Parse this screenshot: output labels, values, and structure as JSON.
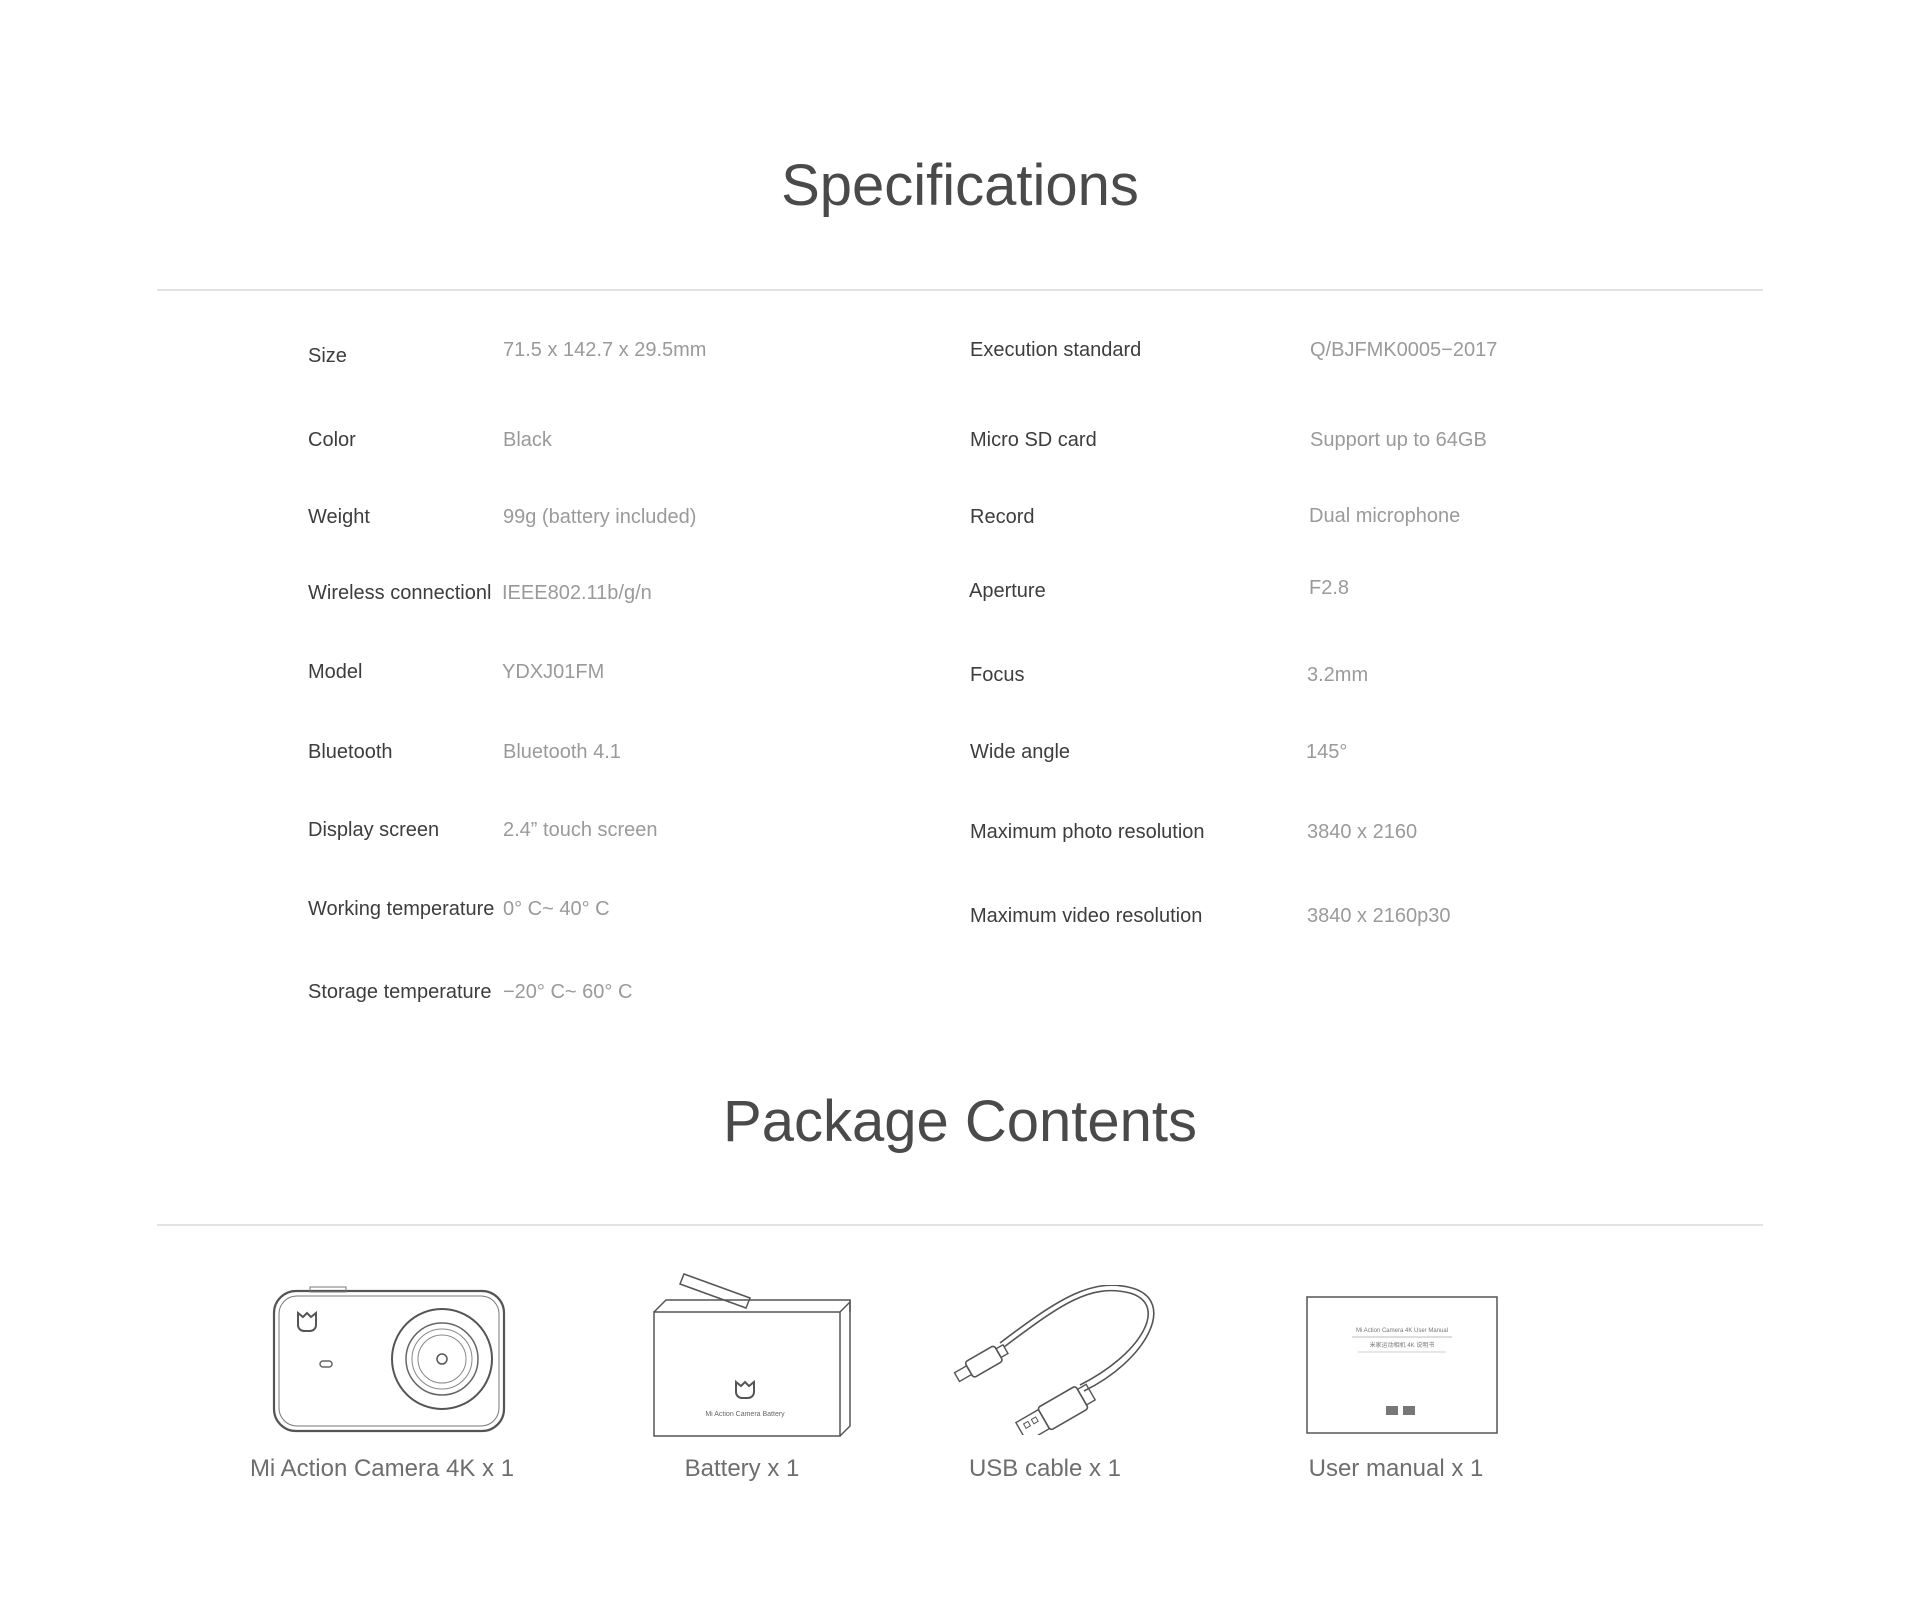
{
  "specifications": {
    "title": "Specifications",
    "left": [
      {
        "label": "Size",
        "value": "71.5 x 142.7 x 29.5mm"
      },
      {
        "label": "Color",
        "value": "Black"
      },
      {
        "label": "Weight",
        "value": "99g (battery included)"
      },
      {
        "label": "Wireless connectionl",
        "value": "IEEE802.11b/g/n"
      },
      {
        "label": "Model",
        "value": "YDXJ01FM"
      },
      {
        "label": "Bluetooth",
        "value": "Bluetooth 4.1"
      },
      {
        "label": "Display screen",
        "value": "2.4” touch screen"
      },
      {
        "label": "Working temperature",
        "value": "0° C~ 40° C"
      },
      {
        "label": "Storage temperature",
        "value": "−20° C~ 60° C"
      }
    ],
    "right": [
      {
        "label": "Execution standard",
        "value": "Q/BJFMK0005−2017"
      },
      {
        "label": "Micro SD card",
        "value": "Support up to 64GB"
      },
      {
        "label": "Record",
        "value": "Dual microphone"
      },
      {
        "label": "Aperture",
        "value": "F2.8"
      },
      {
        "label": "Focus",
        "value": "3.2mm"
      },
      {
        "label": "Wide angle",
        "value": "145°"
      },
      {
        "label": "Maximum photo resolution",
        "value": "3840 x 2160"
      },
      {
        "label": "Maximum video resolution",
        "value": "3840 x 2160p30"
      }
    ]
  },
  "package": {
    "title": "Package Contents",
    "items": [
      {
        "label": "Mi Action Camera 4K x 1",
        "icon": "camera-icon"
      },
      {
        "label": "Battery x 1",
        "icon": "battery-box-icon",
        "box_text": "Mi Action Camera Battery"
      },
      {
        "label": "USB cable x 1",
        "icon": "usb-cable-icon"
      },
      {
        "label": "User manual x 1",
        "icon": "user-manual-icon",
        "manual_title": "Mi Action Camera 4K User Manual",
        "manual_subtitle": "米家运动相机 4K 说明书"
      }
    ]
  },
  "colors": {
    "title": "#4a4a4a",
    "label": "#3d3d3d",
    "value": "#9a9a9a",
    "rule": "#e3e3e3",
    "icon_stroke": "#555555"
  }
}
